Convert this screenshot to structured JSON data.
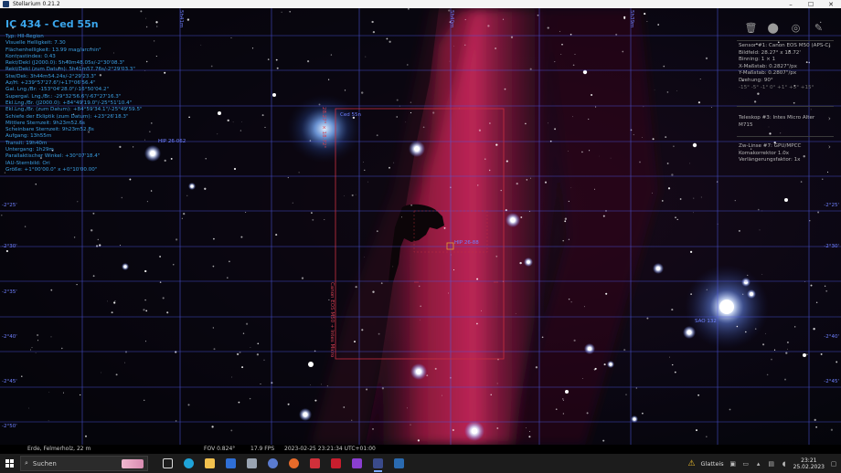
{
  "window": {
    "title": "Stellarium 0.21.2"
  },
  "info": {
    "title": "IC 434 - Ced 55n",
    "lines": [
      "Typ: HII-Region",
      "Visuelle Helligkeit: 7.30",
      "Flächenhelligkeit: 13.99 mag/arcmin²",
      "Kontrastindex: 0.43",
      "Rekt/Dekl (J2000.0): 5h40m48.05s/-2°30'08.3\"",
      "Rekt/Dekl (zum Datum): 5h41m57.76s/-2°29'03.3\"",
      "Stw/Dek: 3h44m54.24s/-2°29'23.3\"",
      "Az/H: +239°57'27.6\"/+17°06'56.4\"",
      "Gal. Lng./Br: -153°04'28.0\"/-16°50'04.2\"",
      "Supergal. Lng./Br.: -29°32'56.6\"/-67°27'16.3\"",
      "Ekl.Lng./Br. (J2000.0): +84°49'19.0\"/-25°51'10.4\"",
      "Ekl.Lng./Br. (zum Datum): +84°59'34.1\"/-25°49'59.5\"",
      "Schiefe der Ekliptik (zum Datum): +23°26'18.3\"",
      "Mittlere Sternzeit: 9h23m52.6s",
      "Scheinbare Sternzeit: 9h23m52.8s",
      "Aufgang: 13h55m",
      "Transit: 19h40m",
      "Untergang: 1h29m",
      "Parallaktischer Winkel: +30°07'18.4\"",
      "IAU-Sternbild: Ori",
      "Größe: +1°00'00.0\" x +0°10'00.00\""
    ]
  },
  "grid": {
    "dec_labels": [
      "-2°25'",
      "-2°30'",
      "-2°35'",
      "-2°40'",
      "-2°45'",
      "-2°50'"
    ],
    "top_labels": [
      "5h41m",
      "5h40m",
      "5h39m"
    ],
    "right_labels": [
      "-2°25'",
      "-2°30'",
      "-2°40'",
      "-2°45'"
    ],
    "star_labels": [
      "HIP 26-062",
      "Ced 55n",
      "HIP 26-88",
      "SAO 132"
    ]
  },
  "frame": {
    "width_label": "28.27° × 18.72°",
    "height_label": "Canon EOS M50 + Intes Micro"
  },
  "right_panel": {
    "sensor": {
      "title": "Sensor #1: Canon EOS M50 (APS-C)",
      "lines": [
        "Bildfeld: 28.27° x 18.72'",
        "Binning: 1 × 1",
        "X-Maßstab: 0.2827\"/px",
        "Y-Maßstab: 0.2807\"/px",
        "Drehung: 90°"
      ],
      "dim_line": "-15° -5° -1° 0° +1° +5° +15°"
    },
    "telescope": {
      "title": "Teleskop #3: Intes Micro Alter M715"
    },
    "lens": {
      "title": "Zw-Linse #7: GPU/MPCC Komakorrektor 1.0x",
      "lines": [
        "Verlängerungsfaktor: 1x"
      ]
    }
  },
  "statusbar": {
    "location": "Erde, Felmerholz, 22 m",
    "fov": "FOV 0.824°",
    "fps": "17.9 FPS",
    "datetime": "2023-02-25 23:21:34 UTC+01:00"
  },
  "taskbar": {
    "search_placeholder": "Suchen",
    "weather": "Glatteis",
    "time": "23:21",
    "date": "25.02.2023"
  },
  "colors": {
    "info_text": "#3a9fe2",
    "grid": "#4f59e6",
    "nebula": "#c02050",
    "frame": "#c83040"
  }
}
